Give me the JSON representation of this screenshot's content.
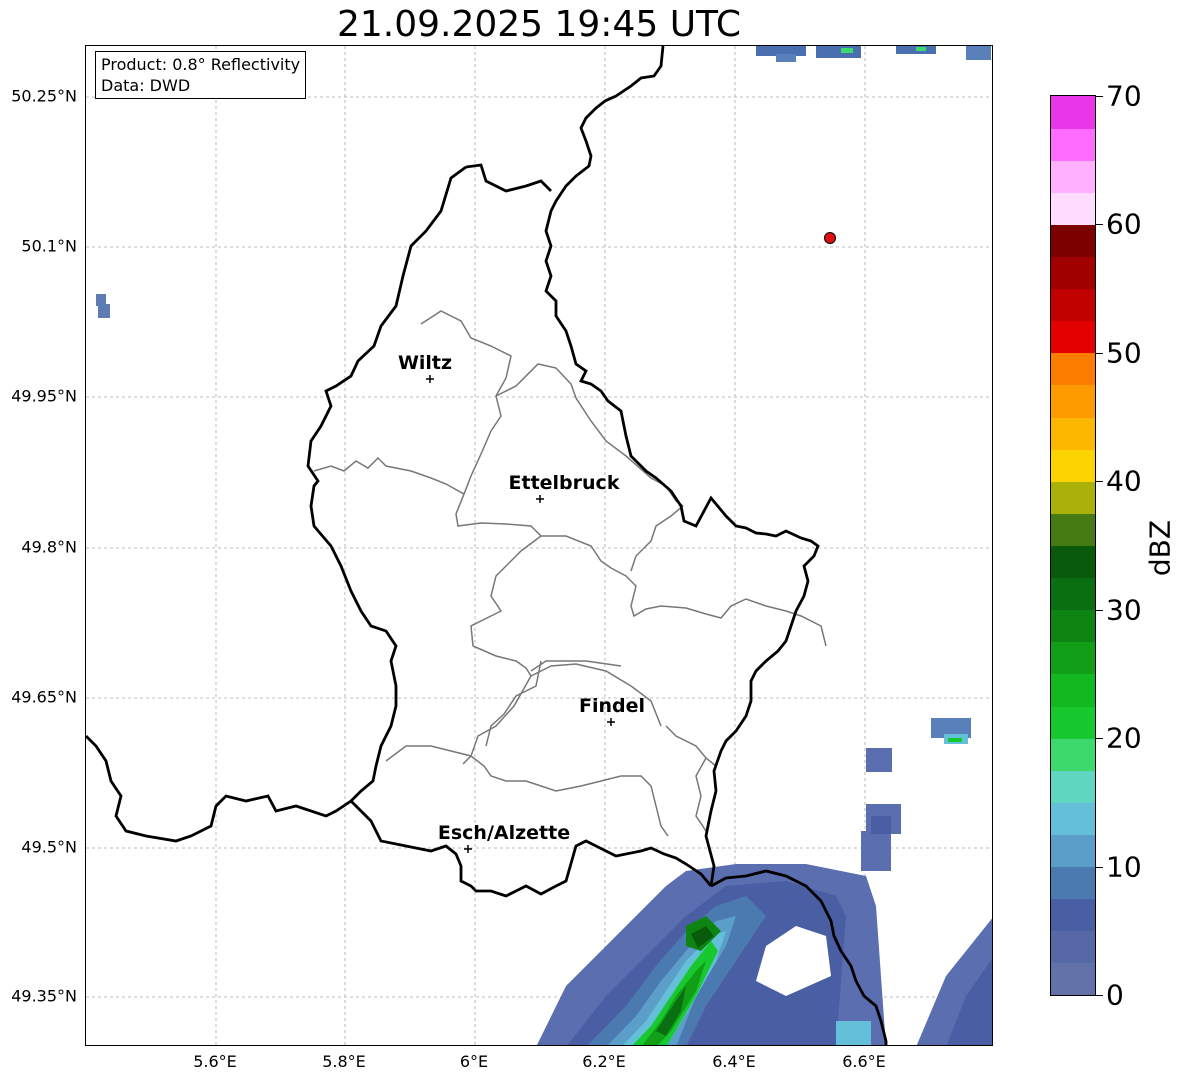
{
  "title": "21.09.2025 19:45 UTC",
  "info": {
    "product": "Product: 0.8° Reflectivity",
    "data_source": "Data: DWD"
  },
  "lat_labels": [
    "50.25°N",
    "50.1°N",
    "49.95°N",
    "49.8°N",
    "49.65°N",
    "49.5°N",
    "49.35°N"
  ],
  "lon_labels": [
    "5.6°E",
    "5.8°E",
    "6°E",
    "6.2°E",
    "6.4°E",
    "6.6°E"
  ],
  "cities": [
    {
      "name": "Wiltz",
      "lon": 5.93,
      "lat": 49.966
    },
    {
      "name": "Ettelbruck",
      "lon": 6.1,
      "lat": 49.847
    },
    {
      "name": "Findel",
      "lon": 6.21,
      "lat": 49.626
    },
    {
      "name": "Esch/Alzette",
      "lon": 5.99,
      "lat": 49.499
    }
  ],
  "marker": {
    "lon": 6.55,
    "lat": 50.11,
    "color": "#e01010"
  },
  "colorbar": {
    "label": "dBZ",
    "min": 0,
    "max": 70,
    "tick_labels": [
      "0",
      "10",
      "20",
      "30",
      "40",
      "50",
      "60",
      "70"
    ],
    "colors": [
      "#6272a8",
      "#5668a6",
      "#4a5fa3",
      "#4a7ab0",
      "#5a9ec9",
      "#63c0d8",
      "#5fd6c0",
      "#3ed96c",
      "#17c92e",
      "#12b81f",
      "#109f16",
      "#0e8512",
      "#0a6f10",
      "#0a5a0c",
      "#467a12",
      "#aab20a",
      "#fcd400",
      "#fcb700",
      "#fc9a00",
      "#fc7c00",
      "#e50000",
      "#c10000",
      "#a10000",
      "#7c0000",
      "#ffdcff",
      "#ffb0ff",
      "#ff6cff",
      "#ea36ea"
    ]
  },
  "extent": {
    "lon_min": 5.4,
    "lon_max": 6.8,
    "lat_min": 49.3,
    "lat_max": 50.3
  }
}
